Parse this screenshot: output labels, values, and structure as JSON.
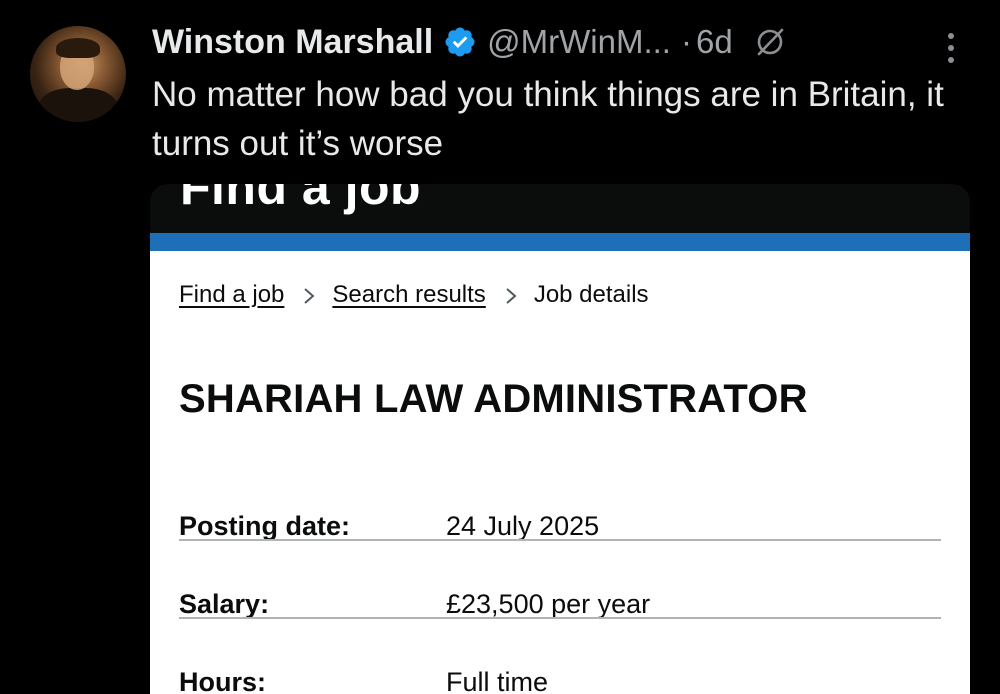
{
  "tweet": {
    "display_name": "Winston Marshall",
    "handle": "@MrWinM...",
    "separator": "·",
    "timestamp": "6d",
    "text": "No matter how bad you think things are in Britain, it turns out it’s worse"
  },
  "icons": {
    "verified": "verified-badge-icon",
    "grok": "grok-icon",
    "more": "more-vertical-icon",
    "breadcrumb_separator": "chevron-right-icon"
  },
  "colors": {
    "background": "#000000",
    "verified_blue": "#1d9bf0",
    "gov_blue": "#1d70b8",
    "divider": "#b1b4b6"
  },
  "card": {
    "site_title": "Find a job",
    "breadcrumb": {
      "items": [
        "Find a job",
        "Search results"
      ],
      "current": "Job details"
    },
    "job_title": "SHARIAH LAW ADMINISTRATOR",
    "details": [
      {
        "key": "Posting date:",
        "value": "24 July 2025"
      },
      {
        "key": "Salary:",
        "value": "£23,500 per year"
      },
      {
        "key": "Hours:",
        "value": "Full time"
      }
    ]
  }
}
